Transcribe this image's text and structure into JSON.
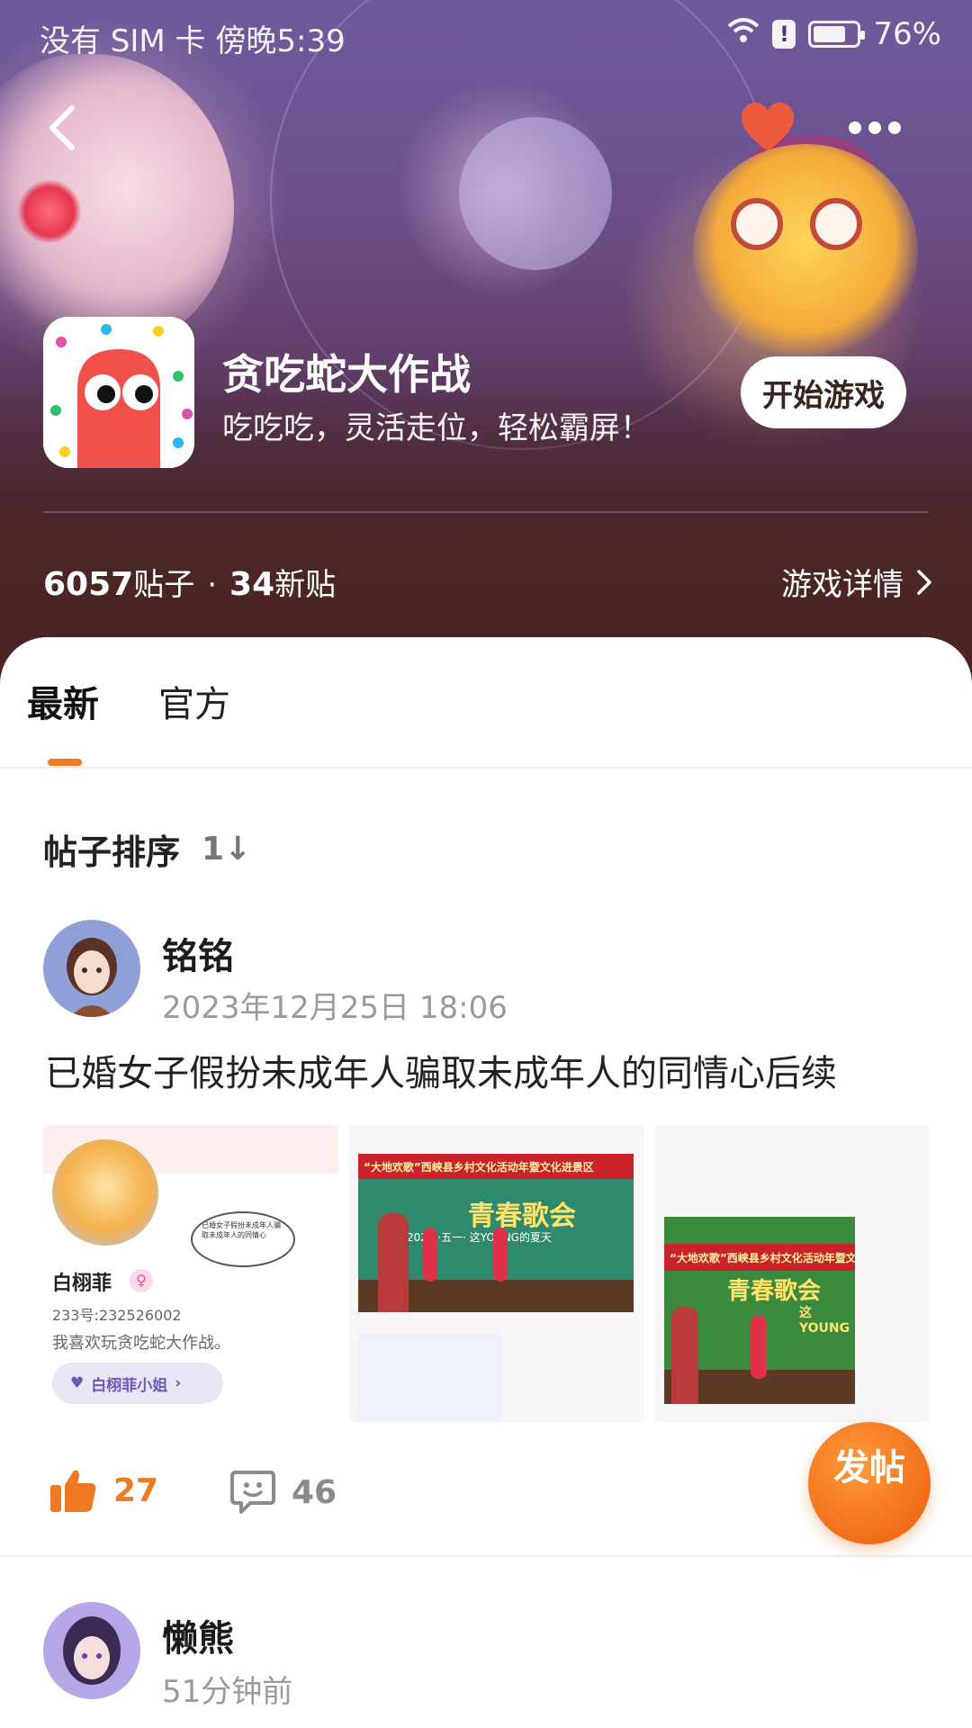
{
  "status_bar": {
    "left_text": "没有 SIM 卡 傍晚5:39",
    "battery": "76%",
    "battery_level": 0.76
  },
  "game": {
    "title": "贪吃蛇大作战",
    "subtitle": "吃吃吃，灵活走位，轻松霸屏！",
    "start_label": "开始游戏",
    "posts_count": "6057",
    "posts_suffix": "贴子",
    "separator": "·",
    "new_count": "34",
    "new_suffix": "新贴",
    "details_label": "游戏详情"
  },
  "tabs": [
    {
      "label": "最新"
    },
    {
      "label": "官方"
    }
  ],
  "sort": {
    "label": "帖子排序",
    "icon_text": "1↓"
  },
  "posts": [
    {
      "author": "铭铭",
      "time": "2023年12月25日 18:06",
      "title": "已婚女子假扮未成年人骗取未成年人的同情心后续",
      "likes": "27",
      "comments": "46",
      "images": [
        {
          "profile_name": "白栩菲",
          "profile_id": "233号:232526002",
          "profile_bio": "我喜欢玩贪吃蛇大作战。",
          "profile_tag": "白栩菲小姐",
          "bubble_text": "已婚女子假扮未成年人骗取未成年人的同情心"
        },
        {
          "banner_title": "“大地欢歌”西峡县乡村文化活动年暨文化进景区",
          "banner_main": "青春歌会",
          "banner_sub": "2023 ·五一· 这YOUNG的夏天"
        },
        {
          "banner_title": "“大地欢歌”西峡县乡村文化活动年暨文化进景区",
          "banner_main": "青春歌会",
          "banner_sub": "这YOUNG"
        }
      ]
    },
    {
      "author": "懒熊",
      "time": "51分钟前"
    }
  ],
  "fab": {
    "label": "发帖"
  },
  "colors": {
    "accent": "#f07a24",
    "like": "#f07a24",
    "hero_bottom": "#4a2523"
  }
}
